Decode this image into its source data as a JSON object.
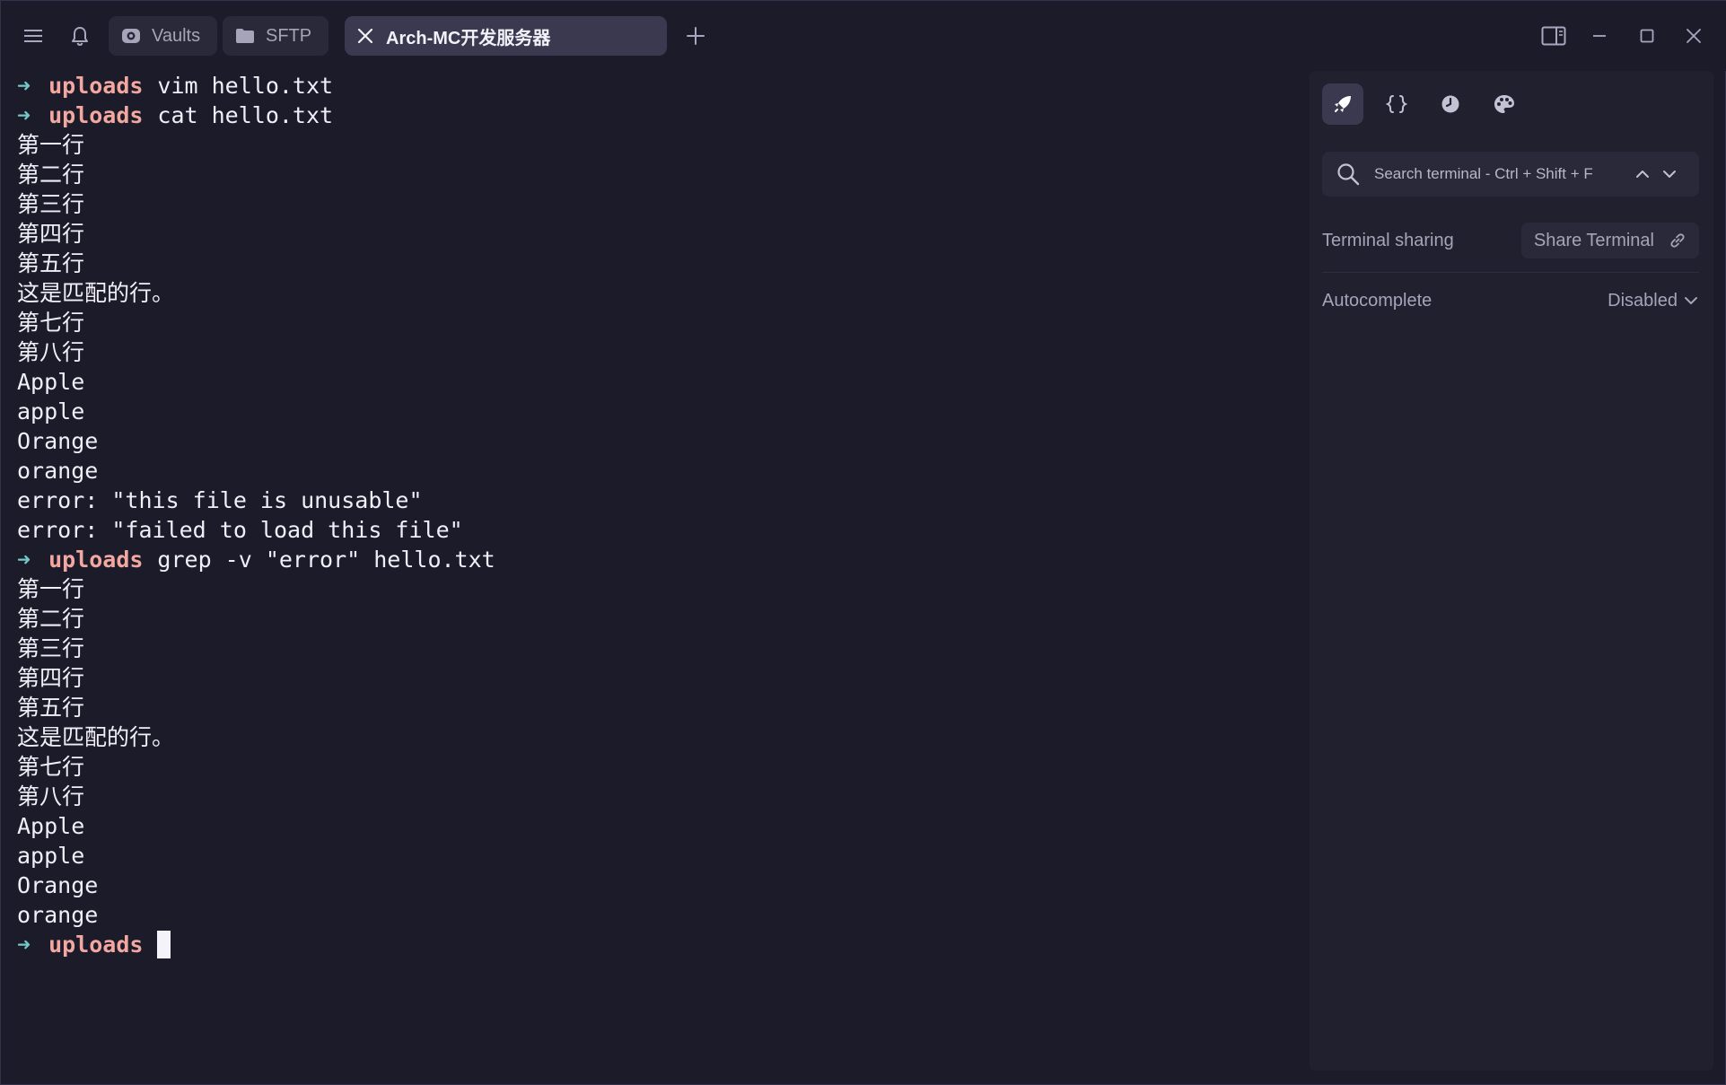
{
  "titlebar": {
    "tabs": [
      {
        "label": "Vaults"
      },
      {
        "label": "SFTP"
      },
      {
        "label": "Arch-MC开发服务器"
      }
    ]
  },
  "terminal": {
    "prompt_arrow": "➜",
    "prompt_dir": "uploads",
    "lines": [
      {
        "type": "cmd",
        "text": "vim hello.txt"
      },
      {
        "type": "cmd",
        "text": "cat hello.txt"
      },
      {
        "type": "out",
        "text": "第一行"
      },
      {
        "type": "out",
        "text": "第二行"
      },
      {
        "type": "out",
        "text": "第三行"
      },
      {
        "type": "out",
        "text": "第四行"
      },
      {
        "type": "out",
        "text": "第五行"
      },
      {
        "type": "out",
        "text": "这是匹配的行。"
      },
      {
        "type": "out",
        "text": "第七行"
      },
      {
        "type": "out",
        "text": "第八行"
      },
      {
        "type": "out",
        "text": "Apple"
      },
      {
        "type": "out",
        "text": "apple"
      },
      {
        "type": "out",
        "text": "Orange"
      },
      {
        "type": "out",
        "text": "orange"
      },
      {
        "type": "out",
        "text": "error: \"this file is unusable\""
      },
      {
        "type": "out",
        "text": "error: \"failed to load this file\""
      },
      {
        "type": "cmd",
        "text": "grep -v \"error\" hello.txt"
      },
      {
        "type": "out",
        "text": "第一行"
      },
      {
        "type": "out",
        "text": "第二行"
      },
      {
        "type": "out",
        "text": "第三行"
      },
      {
        "type": "out",
        "text": "第四行"
      },
      {
        "type": "out",
        "text": "第五行"
      },
      {
        "type": "out",
        "text": "这是匹配的行。"
      },
      {
        "type": "out",
        "text": "第七行"
      },
      {
        "type": "out",
        "text": "第八行"
      },
      {
        "type": "out",
        "text": "Apple"
      },
      {
        "type": "out",
        "text": "apple"
      },
      {
        "type": "out",
        "text": "Orange"
      },
      {
        "type": "out",
        "text": "orange"
      },
      {
        "type": "prompt",
        "text": ""
      }
    ]
  },
  "panel": {
    "search_placeholder": "Search terminal - Ctrl + Shift + F",
    "sharing_label": "Terminal sharing",
    "share_button": "Share Terminal",
    "autocomplete_label": "Autocomplete",
    "autocomplete_value": "Disabled"
  },
  "icons": {
    "menu": "menu-icon",
    "bell": "bell-icon",
    "vaults": "vault-icon",
    "sftp": "folder-icon",
    "tab_close": "close-icon",
    "add_tab": "plus-icon",
    "split": "split-panel-icon",
    "minimize": "minimize-icon",
    "maximize": "maximize-icon",
    "close": "close-icon",
    "snippets": "rocket-icon",
    "code": "braces-icon",
    "history": "clock-icon",
    "theme": "palette-icon",
    "search": "search-icon",
    "link": "link-icon"
  },
  "colors": {
    "background": "#1c1b29",
    "panel": "#21202f",
    "prompt_arrow": "#74c7c7",
    "prompt_dir": "#f3a7a1",
    "text": "#f0eef6"
  }
}
